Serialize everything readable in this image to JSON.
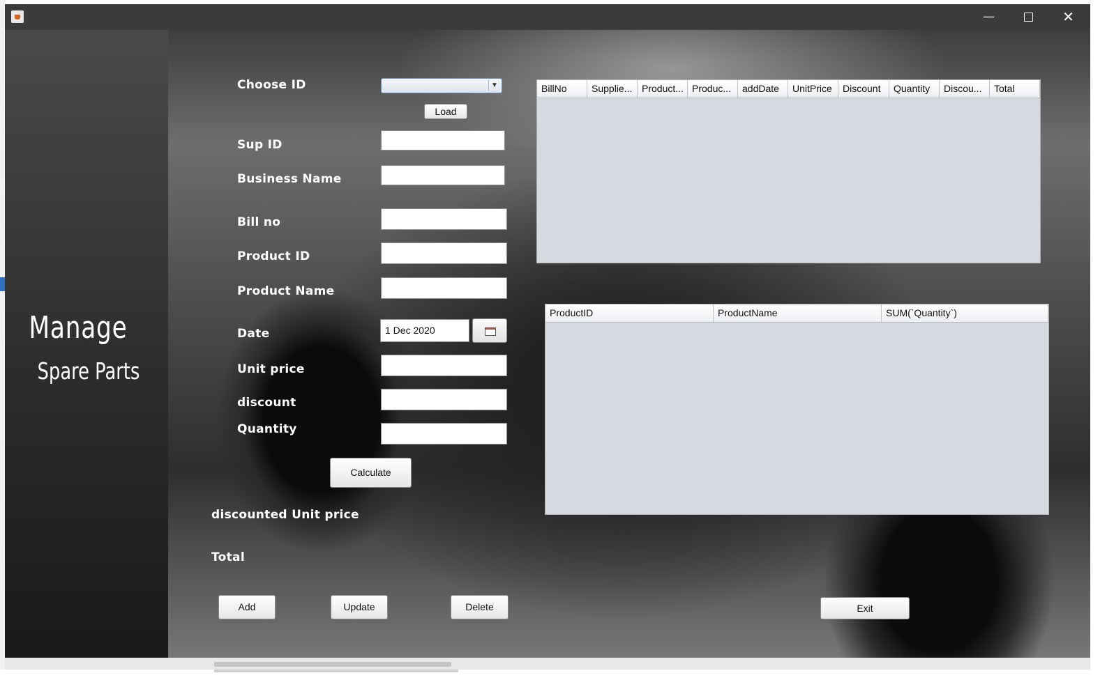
{
  "window": {
    "minimize_label": "—",
    "close_label": "✕"
  },
  "sidebar": {
    "title_line1": "Manage",
    "title_line2": "Spare Parts"
  },
  "form": {
    "choose_id_label": "Choose ID",
    "choose_id_value": "",
    "load_button": "Load",
    "sup_id_label": "Sup ID",
    "business_name_label": "Business Name",
    "bill_no_label": "Bill no",
    "product_id_label": "Product ID",
    "product_name_label": "Product Name",
    "date_label": "Date",
    "date_value": "1 Dec 2020",
    "unit_price_label": "Unit  price",
    "discount_label": "discount",
    "quantity_label": "Quantity",
    "calculate_button": "Calculate",
    "discounted_unit_price_label": "discounted Unit  price",
    "total_label": "Total"
  },
  "actions": {
    "add": "Add",
    "update": "Update",
    "delete": "Delete",
    "exit": "Exit"
  },
  "bills_table": {
    "columns": [
      "BillNo",
      "Supplie...",
      "Product...",
      "Produc...",
      "addDate",
      "UnitPrice",
      "Discount",
      "Quantity",
      "Discou...",
      "Total"
    ]
  },
  "summary_table": {
    "columns": [
      "ProductID",
      "ProductName",
      "SUM(`Quantity`)"
    ]
  },
  "colors": {
    "titlebar": "#3b3b3b",
    "table_body": "#d6d9e0",
    "label_text": "#ffffff"
  },
  "icons": [
    "java-app-icon",
    "minimize-icon",
    "maximize-icon",
    "close-icon",
    "dropdown-arrow-icon",
    "calendar-icon"
  ]
}
